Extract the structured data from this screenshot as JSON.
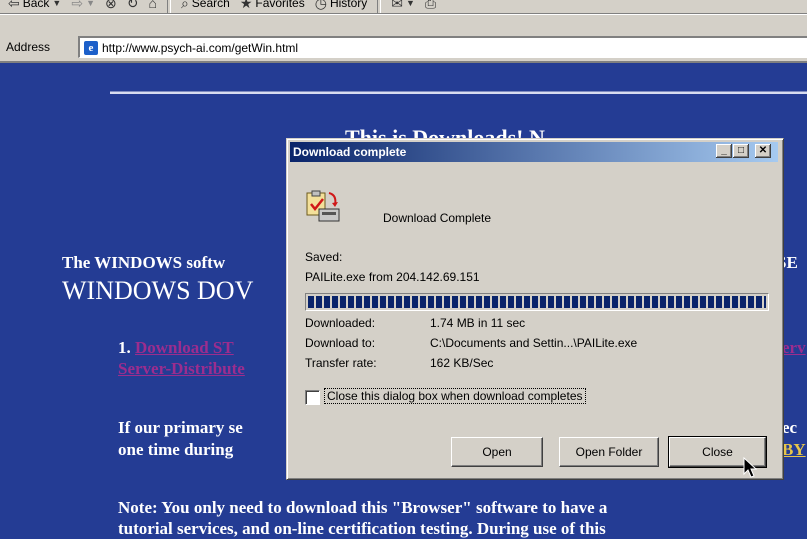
{
  "toolbar": {
    "back": "Back",
    "search": "Search",
    "favorites": "Favorites",
    "history": "History"
  },
  "address": {
    "label": "Address",
    "url": "http://www.psych-ai.com/getWin.html"
  },
  "page": {
    "title_partial": "This is Downloads! N",
    "windows_line1": "The WINDOWS softw",
    "windows_line2": "WINDOWS DOV",
    "right_se": "SE",
    "list1_num": "1.",
    "list1_link": "Download ST",
    "list1_right": "erv",
    "list1_line2": "Server-Distribute",
    "primary_line": "If our primary se",
    "primary_right": "ec",
    "onetime_line": "one time during",
    "onetime_right": "BY",
    "note_line": "Note: You only need to download this \"Browser\" software to have a",
    "tutorial_line": "tutorial services, and on-line certification testing. During use of this"
  },
  "dialog": {
    "title": "Download complete",
    "heading": "Download Complete",
    "saved_label": "Saved:",
    "saved_value": "PAILite.exe from 204.142.69.151",
    "progress_percent": 100,
    "downloaded_label": "Downloaded:",
    "downloaded_value": "1.74 MB in 11 sec",
    "download_to_label": "Download to:",
    "download_to_value": "C:\\Documents and Settin...\\PAILite.exe",
    "transfer_rate_label": "Transfer rate:",
    "transfer_rate_value": "162 KB/Sec",
    "close_checkbox_label": "Close this dialog box when download completes",
    "close_checkbox_checked": false,
    "open_button": "Open",
    "open_folder_button": "Open Folder",
    "close_button": "Close"
  },
  "colors": {
    "page_background": "#243c94",
    "link_visited": "#9c2d8e",
    "titlebar_start": "#0a246a",
    "titlebar_end": "#a6caf0"
  }
}
